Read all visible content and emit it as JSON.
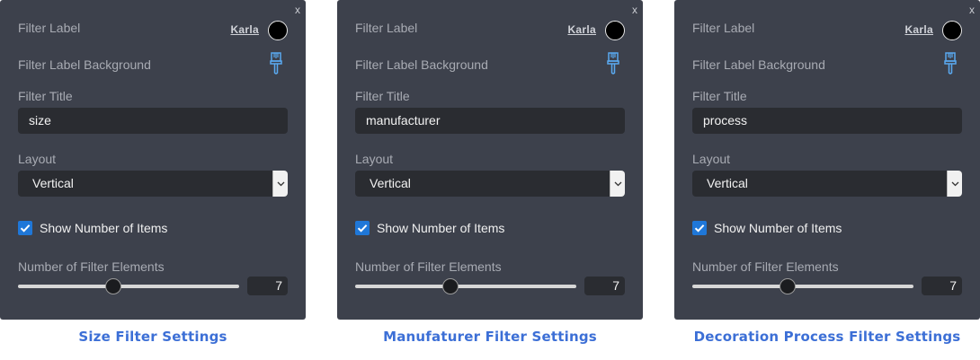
{
  "panels": [
    {
      "close": "x",
      "filter_label": "Filter Label",
      "font_name": "Karla",
      "label_color": "#000000",
      "filter_label_background": "Filter Label Background",
      "filter_title_label": "Filter Title",
      "filter_title_value": "size",
      "layout_label": "Layout",
      "layout_value": "Vertical",
      "show_items_label": "Show Number of Items",
      "show_items_checked": true,
      "elements_label": "Number of Filter Elements",
      "elements_value": "7",
      "slider_fraction": 0.43,
      "caption": "Size Filter Settings"
    },
    {
      "close": "x",
      "filter_label": "Filter Label",
      "font_name": "Karla",
      "label_color": "#000000",
      "filter_label_background": "Filter Label Background",
      "filter_title_label": "Filter Title",
      "filter_title_value": "manufacturer",
      "layout_label": "Layout",
      "layout_value": "Vertical",
      "show_items_label": "Show Number of Items",
      "show_items_checked": true,
      "elements_label": "Number of Filter Elements",
      "elements_value": "7",
      "slider_fraction": 0.43,
      "caption": "Manufaturer Filter Settings"
    },
    {
      "close": "x",
      "filter_label": "Filter Label",
      "font_name": "Karla",
      "label_color": "#000000",
      "filter_label_background": "Filter Label Background",
      "filter_title_label": "Filter Title",
      "filter_title_value": "process",
      "layout_label": "Layout",
      "layout_value": "Vertical",
      "show_items_label": "Show Number of Items",
      "show_items_checked": true,
      "elements_label": "Number of Filter Elements",
      "elements_value": "7",
      "slider_fraction": 0.43,
      "caption": "Decoration Process Filter Settings"
    }
  ],
  "colors": {
    "panel_bg": "#3d414c",
    "field_bg": "#2a2c31",
    "accent": "#1f77d8",
    "caption": "#3c6fd6"
  },
  "icons": [
    "close-icon",
    "paint-brush-icon",
    "chevron-down-icon",
    "checkmark-icon"
  ]
}
